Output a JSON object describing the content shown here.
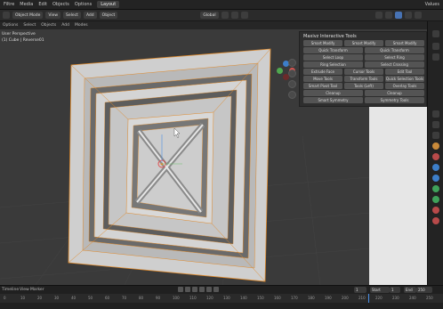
{
  "menu": {
    "items": [
      "Filtre",
      "Media",
      "Edit",
      "Objects",
      "Options"
    ],
    "right": "Values"
  },
  "header": {
    "workspace": "Layout",
    "tab_active": "Object",
    "mode": "Object Mode",
    "view": "View",
    "select": "Select",
    "add": "Add",
    "object": "Object",
    "global": "Global"
  },
  "subheader": {
    "items": [
      "Options",
      "Select",
      "Objects",
      "Add",
      "Modes"
    ]
  },
  "viewport": {
    "title": "User Perspective",
    "subtitle": "(1) Cube | Reverse01"
  },
  "panel": {
    "title": "Maxivz Interactive Tools",
    "buttons": [
      [
        "Smart Modify",
        "Smart Modify",
        "Smart Modify"
      ],
      [
        "Quick Transform",
        "Quick Transform"
      ],
      [
        "Select Loop",
        "Select Ring"
      ],
      [
        "Ring Selection",
        "Select Crossing"
      ],
      [
        "Extrude Face",
        "Cursor Tools",
        "Edit Tool"
      ],
      [
        "Move Tools",
        "Transform Tools",
        "Quick Selection Tools"
      ],
      [
        "Smart Pivot Tool",
        "Tools (Left)",
        "Overlay Tools"
      ],
      [
        "Cleanup",
        "Cleanup"
      ],
      [
        "Smart Symmetry",
        "Symmetry Tools"
      ]
    ]
  },
  "timeline": {
    "ticks": [
      "0",
      "10",
      "20",
      "30",
      "40",
      "50",
      "60",
      "70",
      "80",
      "90",
      "100",
      "110",
      "120",
      "130",
      "140",
      "150",
      "160",
      "170",
      "180",
      "190",
      "200",
      "210",
      "220",
      "230",
      "240",
      "250"
    ],
    "start": "Start",
    "start_val": "1",
    "end": "End",
    "end_val": "250",
    "frame": "1"
  },
  "status": {
    "left": "Timeline",
    "view": "View",
    "marker": "Marker"
  },
  "colors": {
    "accent": "#4772b3",
    "wire": "#e08a2b",
    "mesh": "#c9c9c9"
  }
}
